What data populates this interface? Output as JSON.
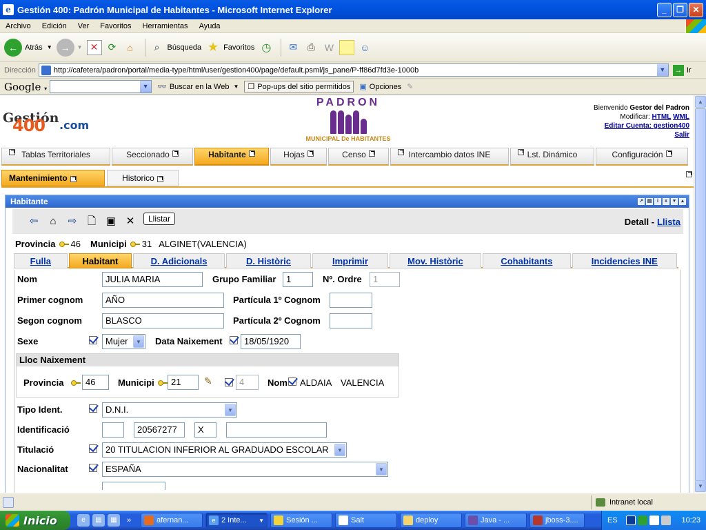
{
  "window": {
    "title": "Gestión 400: Padrón Municipal de Habitantes - Microsoft Internet Explorer"
  },
  "menu": [
    "Archivo",
    "Edición",
    "Ver",
    "Favoritos",
    "Herramientas",
    "Ayuda"
  ],
  "toolbar": {
    "back": "Atrás",
    "search": "Búsqueda",
    "favorites": "Favoritos"
  },
  "address": {
    "label": "Dirección",
    "url": "http://cafetera/padron/portal/media-type/html/user/gestion400/page/default.psml/js_pane/P-ff86d7fd3e-1000b",
    "go": "Ir"
  },
  "google_bar": {
    "logo": "Google",
    "search_web": "Buscar en la Web",
    "popups": "Pop-ups del sitio permitidos",
    "options": "Opciones"
  },
  "page": {
    "logo": {
      "top": "Gestión",
      "mid": "400",
      "tail": ".com"
    },
    "banner": {
      "title": "PADRON",
      "subtitle": "MUNICIPAL De HABITANTES"
    },
    "welcome": {
      "greeting": "Bienvenido",
      "user": "Gestor del Padron",
      "modify_label": "Modificar:",
      "html": "HTML",
      "wml": "WML",
      "edit_account": "Editar Cuenta: gestion400",
      "exit": "Salir"
    },
    "main_tabs": [
      {
        "label": "Tablas Territoriales",
        "active": false
      },
      {
        "label": "Seccionado",
        "active": false
      },
      {
        "label": "Habitante",
        "active": true
      },
      {
        "label": "Hojas",
        "active": false
      },
      {
        "label": "Censo",
        "active": false
      },
      {
        "label": "Intercambio datos INE",
        "active": false
      },
      {
        "label": "Lst. Dinámico",
        "active": false
      },
      {
        "label": "Configuración",
        "active": false
      }
    ],
    "sub_tabs": [
      {
        "label": "Mantenimiento",
        "active": true
      },
      {
        "label": "Historico",
        "active": false
      }
    ],
    "portlet": {
      "title": "Habitante",
      "llistar": "Llistar",
      "view_label": "Detall -",
      "view_link": "Llista",
      "provincia_label": "Provincia",
      "provincia_value": "46",
      "municipi_label": "Municipi",
      "municipi_value": "31",
      "municipi_name": "ALGINET(VALENCIA)",
      "detail_tabs": [
        {
          "label": "Fulla",
          "active": false
        },
        {
          "label": "Habitant",
          "active": true
        },
        {
          "label": "D. Adicionals",
          "active": false
        },
        {
          "label": "D. Històric",
          "active": false
        },
        {
          "label": "Imprimir",
          "active": false
        },
        {
          "label": "Mov. Històric",
          "active": false
        },
        {
          "label": "Cohabitants",
          "active": false
        },
        {
          "label": "Incidencies INE",
          "active": false
        }
      ]
    },
    "form": {
      "nom": {
        "label": "Nom",
        "value": "JULIA MARIA"
      },
      "grupo_familiar": {
        "label": "Grupo Familiar",
        "value": "1"
      },
      "n_ordre": {
        "label": "Nº. Ordre",
        "value": "1"
      },
      "primer_cognom": {
        "label": "Primer cognom",
        "value": "AÑO"
      },
      "particula1": {
        "label": "Partícula 1º Cognom",
        "value": ""
      },
      "segon_cognom": {
        "label": "Segon cognom",
        "value": "BLASCO"
      },
      "particula2": {
        "label": "Partícula 2º Cognom",
        "value": ""
      },
      "sexe": {
        "label": "Sexe",
        "value": "Mujer"
      },
      "data_naixement": {
        "label": "Data Naixement",
        "value": "18/05/1920"
      },
      "lloc_naixement": {
        "title": "Lloc Naixement",
        "provincia_label": "Provincia",
        "provincia_value": "46",
        "municipi_label": "Municipi",
        "municipi_value": "21",
        "extra_value": "4",
        "nom_label": "Nom",
        "nom_value": "ALDAIA",
        "province_name": "VALENCIA"
      },
      "tipo_ident": {
        "label": "Tipo Ident.",
        "value": "D.N.I."
      },
      "identificacio": {
        "label": "Identificació",
        "v1": "",
        "v2": "20567277",
        "v3": "X",
        "v4": ""
      },
      "titulacio": {
        "label": "Titulació",
        "value": "20 TITULACION INFERIOR AL GRADUADO ESCOLAR"
      },
      "nacionalitat": {
        "label": "Nacionalitat",
        "value": "ESPAÑA"
      }
    }
  },
  "status": {
    "zone": "Intranet local"
  },
  "taskbar": {
    "start": "Inicio",
    "tasks": [
      {
        "label": "afernan...",
        "active": false
      },
      {
        "label": "2 Inte...",
        "active": true
      },
      {
        "label": "Sesión ...",
        "active": false
      },
      {
        "label": "Salt",
        "active": false
      },
      {
        "label": "deploy",
        "active": false
      },
      {
        "label": "Java - ...",
        "active": false
      },
      {
        "label": "jboss-3....",
        "active": false
      }
    ],
    "lang": "ES",
    "clock": "10:23"
  }
}
